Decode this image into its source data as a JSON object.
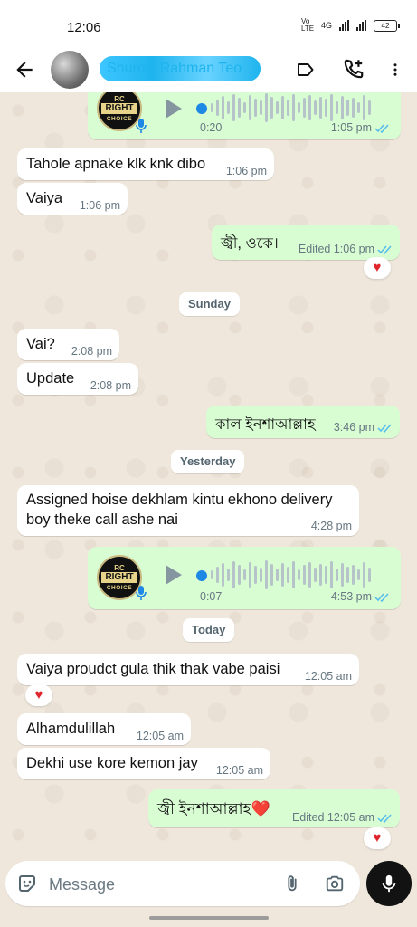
{
  "status_bar": {
    "time": "12:06",
    "network": "Vo LTE",
    "signal": "4G",
    "battery": "42"
  },
  "app_bar": {
    "contact_name": "Shurovi Rahman Teo"
  },
  "messages": [
    {
      "type": "voice",
      "direction": "out",
      "duration": "0:20",
      "time": "1:05 pm",
      "status": "read",
      "logo": {
        "top": "RC",
        "middle": "RIGHT",
        "bottom": "CHOICE"
      }
    },
    {
      "type": "text",
      "direction": "in",
      "text": "Tahole apnake klk knk dibo",
      "time": "1:06 pm"
    },
    {
      "type": "text",
      "direction": "in",
      "text": "Vaiya",
      "time": "1:06 pm"
    },
    {
      "type": "text",
      "direction": "out",
      "text": "জ্বী, ওকে।",
      "time": "Edited 1:06 pm",
      "status": "read",
      "reaction": "♥"
    },
    {
      "type": "day",
      "text": "Sunday"
    },
    {
      "type": "text",
      "direction": "in",
      "text": "Vai?",
      "time": "2:08 pm"
    },
    {
      "type": "text",
      "direction": "in",
      "text": "Update",
      "time": "2:08 pm"
    },
    {
      "type": "text",
      "direction": "out",
      "text": "কাল ইনশাআল্লাহ",
      "time": "3:46 pm",
      "status": "read"
    },
    {
      "type": "day",
      "text": "Yesterday"
    },
    {
      "type": "text",
      "direction": "in",
      "text_lines": [
        "Assigned hoise dekhlam kintu ekhono delivery",
        "boy theke call ashe nai"
      ],
      "time": "4:28 pm"
    },
    {
      "type": "voice",
      "direction": "out",
      "duration": "0:07",
      "time": "4:53 pm",
      "status": "read"
    },
    {
      "type": "day",
      "text": "Today"
    },
    {
      "type": "text",
      "direction": "in",
      "text": "Vaiya proudct gula thik thak vabe paisi",
      "time": "12:05 am",
      "reaction": "♥"
    },
    {
      "type": "text",
      "direction": "in",
      "text": "Alhamdulillah",
      "time": "12:05 am"
    },
    {
      "type": "text",
      "direction": "in",
      "text": "Dekhi use kore kemon jay",
      "time": "12:05 am"
    },
    {
      "type": "text",
      "direction": "out",
      "text": "জ্বী ইনশাআল্লাহ❤️",
      "time": "Edited 12:05 am",
      "status": "read",
      "reaction": "♥"
    }
  ],
  "composer": {
    "placeholder": "Message"
  },
  "colors": {
    "outgoing": "#d9fdd3",
    "incoming": "#ffffff",
    "read_tick": "#53bdeb",
    "wallpaper": "#efe7dc",
    "heart": "#e0242b"
  },
  "icons": [
    "back-arrow-icon",
    "label-icon",
    "add-call-icon",
    "more-icon",
    "emoji-icon",
    "attach-icon",
    "camera-icon",
    "mic-icon",
    "play-icon"
  ]
}
